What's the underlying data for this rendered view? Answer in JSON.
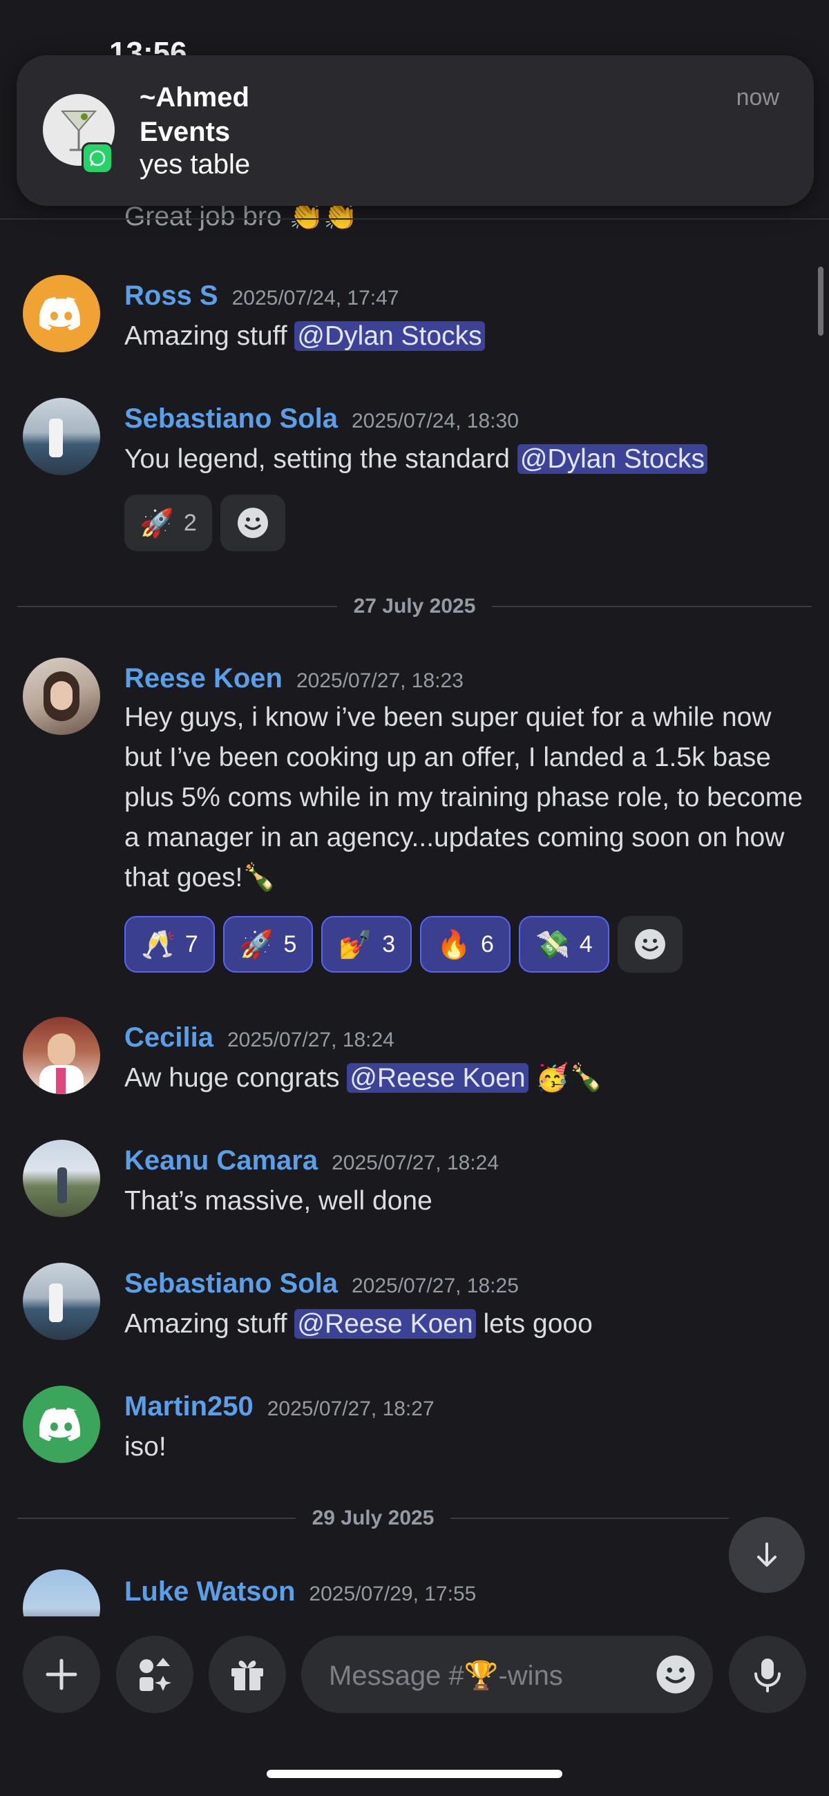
{
  "status_bar": {
    "time": "13:56"
  },
  "notification": {
    "app": "WhatsApp",
    "sender": "~Ahmed Events",
    "sender_line1": "~Ahmed",
    "sender_line2": "Events",
    "message": "yes table",
    "time": "now"
  },
  "partial_top_message": "Great job bro",
  "messages": [
    {
      "user": "Ross S",
      "time": "2025/07/24, 17:47",
      "text_before": "Amazing stuff ",
      "mention": "@Dylan Stocks",
      "text_after": "",
      "avatar": "discord-logo-orange"
    },
    {
      "user": "Sebastiano Sola",
      "time": "2025/07/24, 18:30",
      "text_before": "You legend, setting the standard ",
      "mention": "@Dylan Stocks",
      "text_after": "",
      "avatar": "photo-coast",
      "reactions": [
        {
          "emoji": "🚀",
          "count": "2",
          "active": false
        }
      ]
    },
    {
      "user": "Reese Koen",
      "time": "2025/07/27, 18:23",
      "text": "Hey guys, i know i’ve been super quiet for a while now but I’ve been cooking up an offer, I landed a 1.5k base plus 5% coms  while in my training phase role, to become a manager in an agency...updates coming soon on how that goes!🍾",
      "avatar": "photo-selfie",
      "reactions": [
        {
          "emoji": "🥂",
          "count": "7",
          "active": true
        },
        {
          "emoji": "🚀",
          "count": "5",
          "active": true
        },
        {
          "emoji": "💅",
          "count": "3",
          "active": true
        },
        {
          "emoji": "🔥",
          "count": "6",
          "active": true
        },
        {
          "emoji": "💸",
          "count": "4",
          "active": true
        }
      ]
    },
    {
      "user": "Cecilia",
      "time": "2025/07/27, 18:24",
      "text_before": "Aw huge congrats ",
      "mention": "@Reese Koen",
      "text_after": " 🥳🍾",
      "avatar": "photo-portrait"
    },
    {
      "user": "Keanu Camara",
      "time": "2025/07/27, 18:24",
      "text": "That’s massive, well done",
      "avatar": "photo-landscape"
    },
    {
      "user": "Sebastiano Sola",
      "time": "2025/07/27, 18:25",
      "text_before": "Amazing stuff ",
      "mention": "@Reese Koen",
      "text_after": " lets gooo",
      "avatar": "photo-coast"
    },
    {
      "user": "Martin250",
      "time": "2025/07/27, 18:27",
      "text": "iso!",
      "avatar": "discord-logo-green"
    },
    {
      "user": "Luke Watson",
      "time": "2025/07/29, 17:55",
      "text": "",
      "avatar": "photo-group"
    }
  ],
  "dividers": [
    "27 July 2025",
    "29 July 2025"
  ],
  "composer": {
    "placeholder": "Message #🏆-wins"
  },
  "colors": {
    "background": "#1a1a1e",
    "username": "#5b9fe8",
    "mention_bg": "#3c4396",
    "reaction_active": "#3a3f8f",
    "blurple": "#5865f2"
  },
  "icons": [
    "plus-icon",
    "apps-icon",
    "gift-icon",
    "emoji-icon",
    "mic-icon",
    "arrow-down-icon",
    "whatsapp-icon",
    "cocktail-icon",
    "discord-icon"
  ]
}
